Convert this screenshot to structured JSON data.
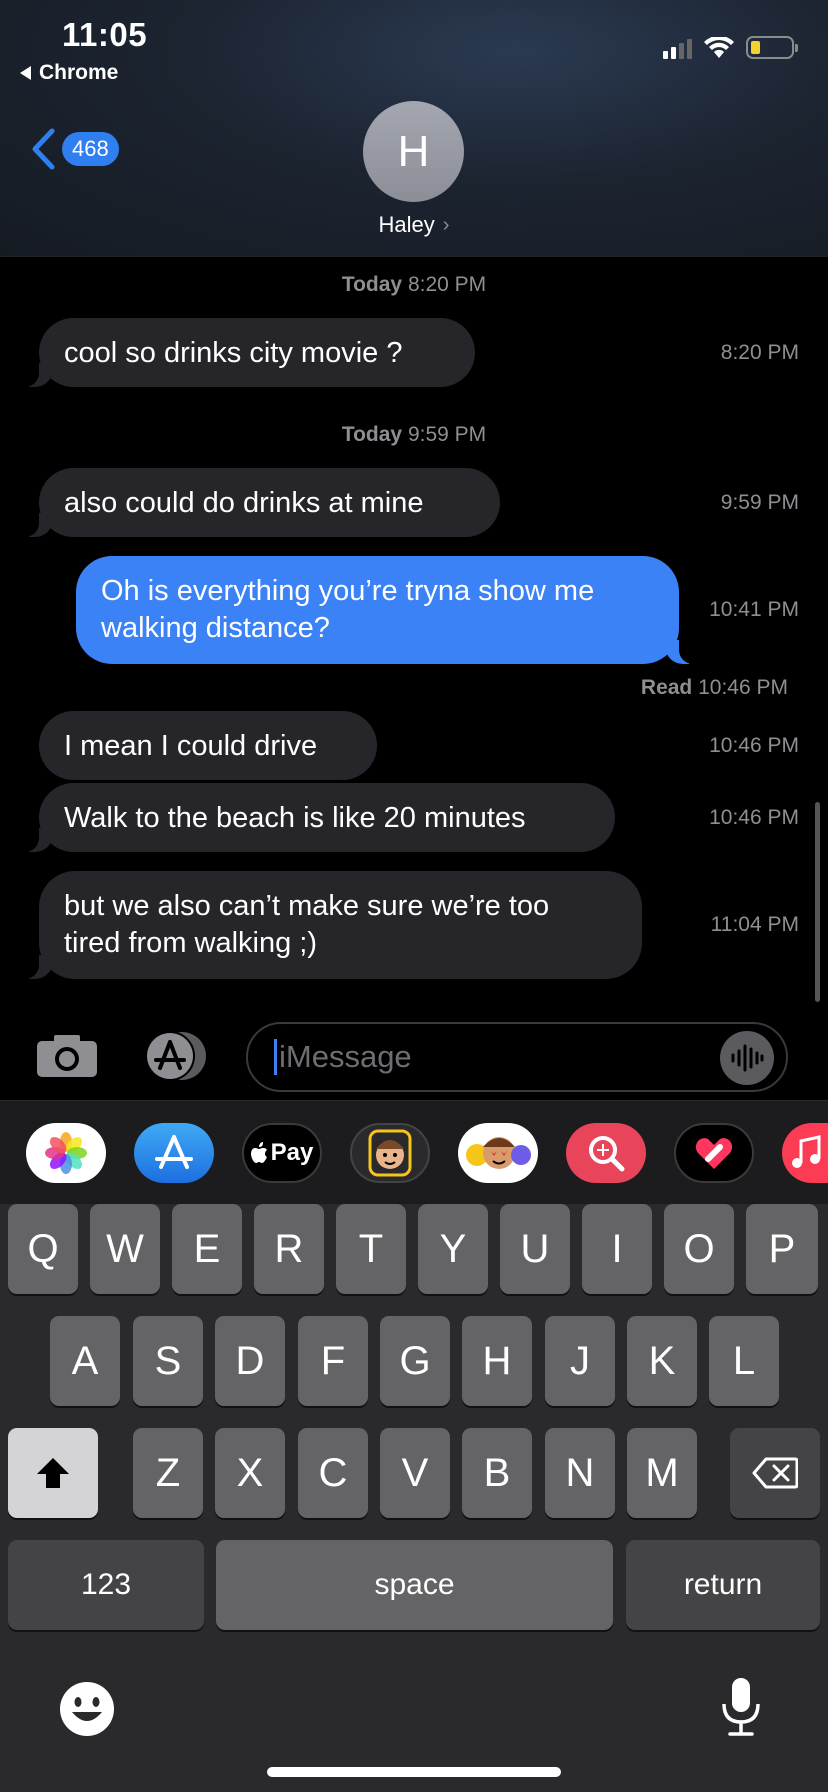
{
  "status_bar": {
    "time": "11:05",
    "back_app": "Chrome"
  },
  "header": {
    "unread_count": "468",
    "avatar_initial": "H",
    "contact_name": "Haley",
    "chevron": "›"
  },
  "thread": {
    "stamp1": {
      "day": "Today",
      "time": "8:20 PM"
    },
    "msg1": {
      "text": "cool so drinks city movie ?",
      "time": "8:20 PM"
    },
    "stamp2": {
      "day": "Today",
      "time": "9:59 PM"
    },
    "msg2": {
      "text": "also could do drinks at mine",
      "time": "9:59 PM"
    },
    "msg3": {
      "line1": "Oh is everything you’re tryna show me",
      "line2": "walking distance?",
      "time": "10:41 PM"
    },
    "read_receipt": {
      "label": "Read",
      "time": "10:46 PM"
    },
    "msg4": {
      "text": "I mean I could drive",
      "time": "10:46 PM"
    },
    "msg5": {
      "text": "Walk to the beach is like 20 minutes",
      "time": "10:46 PM"
    },
    "msg6": {
      "line1": "but we also can’t make sure we’re too",
      "line2": "tired from walking ;)",
      "time": "11:04 PM"
    }
  },
  "composer": {
    "placeholder": "iMessage"
  },
  "app_drawer": {
    "apps": [
      "photos-icon",
      "app-store-icon",
      "apple-pay-icon",
      "memoji-icon",
      "animoji-stickers-icon",
      "search-images-icon",
      "digital-touch-icon",
      "music-icon"
    ],
    "apple_pay_label": "Pay"
  },
  "keyboard": {
    "row1": [
      "Q",
      "W",
      "E",
      "R",
      "T",
      "Y",
      "U",
      "I",
      "O",
      "P"
    ],
    "row2": [
      "A",
      "S",
      "D",
      "F",
      "G",
      "H",
      "J",
      "K",
      "L"
    ],
    "row3": [
      "Z",
      "X",
      "C",
      "V",
      "B",
      "N",
      "M"
    ],
    "numbers_label": "123",
    "space_label": "space",
    "return_label": "return"
  },
  "colors": {
    "outgoing_bubble": "#3b82f6",
    "incoming_bubble": "#26262a",
    "badge": "#2f7ff0"
  }
}
